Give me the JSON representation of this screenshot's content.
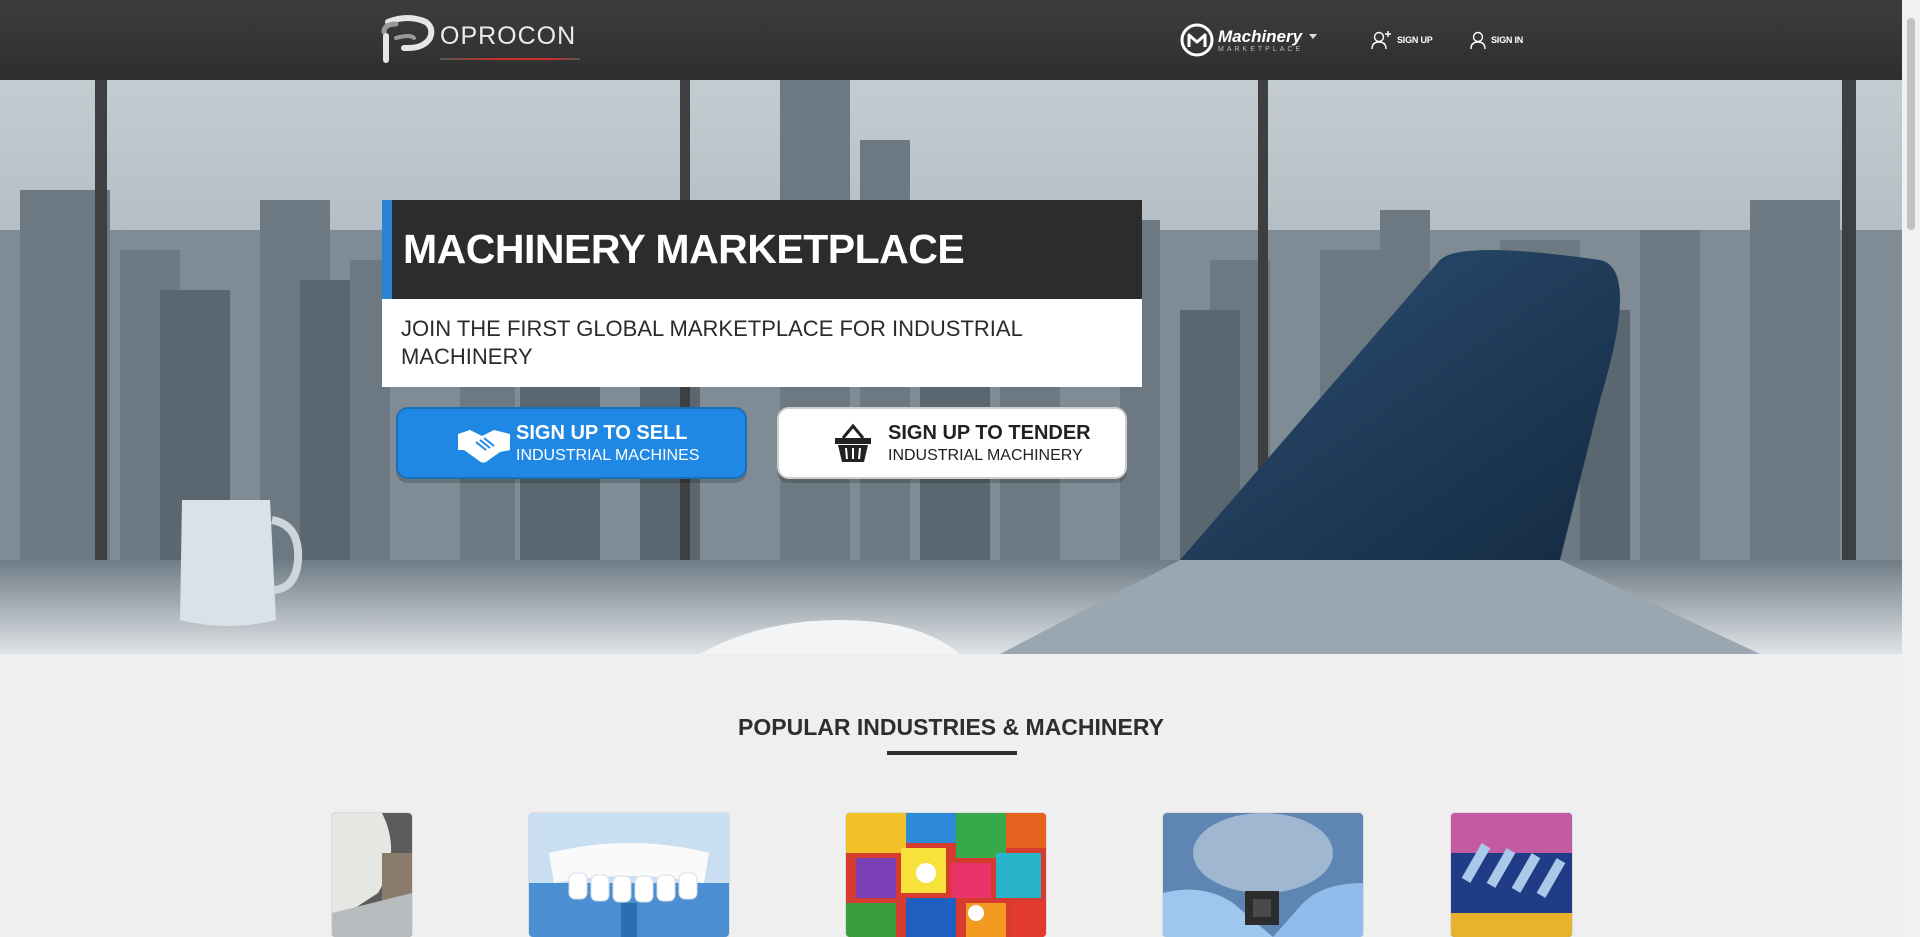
{
  "header": {
    "logo_text": "OPROCON",
    "brand": {
      "title": "Machinery",
      "subtitle": "MARKETPLACE"
    },
    "nav": {
      "signup": "SIGN UP",
      "signin": "SIGN IN"
    }
  },
  "hero": {
    "title": "MACHINERY MARKETPLACE",
    "subtitle": "JOIN THE FIRST GLOBAL MARKETPLACE FOR INDUSTRIAL MACHINERY",
    "cta_sell": {
      "main": "SIGN UP TO SELL",
      "minor": "INDUSTRIAL MACHINES"
    },
    "cta_tender": {
      "main": "SIGN UP TO TENDER",
      "minor": "INDUSTRIAL MACHINERY"
    }
  },
  "popular": {
    "title": "POPULAR INDUSTRIES & MACHINERY"
  },
  "colors": {
    "accent": "#1f88e5",
    "header_bg": "#333333",
    "title_bg": "#2b2c2d"
  },
  "icons": [
    "oprocon-logo-icon",
    "machinery-marketplace-icon",
    "user-plus-icon",
    "user-icon",
    "handshake-icon",
    "basket-icon"
  ]
}
